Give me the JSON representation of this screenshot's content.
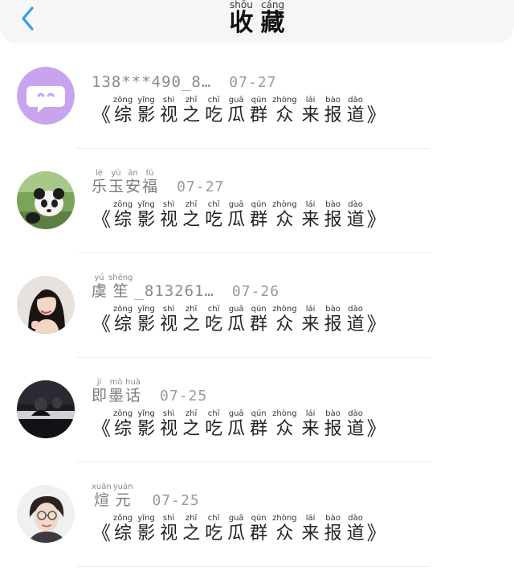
{
  "header": {
    "title": [
      {
        "py": "shōu",
        "hz": "收"
      },
      {
        "py": "cáng",
        "hz": "藏"
      }
    ]
  },
  "colors": {
    "accent": "#2f9ff0",
    "header_bg": "#f6f6f6"
  },
  "items": [
    {
      "avatar": "chat-bubble-avatar",
      "plain_name": "138***490_8…",
      "name_ruby": [],
      "date": "07-27"
    },
    {
      "avatar": "panda-photo-avatar",
      "plain_name": "",
      "name_ruby": [
        {
          "py": "lè",
          "hz": "乐"
        },
        {
          "py": "yù",
          "hz": "玉"
        },
        {
          "py": "ān",
          "hz": "安"
        },
        {
          "py": "fú",
          "hz": "福"
        }
      ],
      "date": "07-27"
    },
    {
      "avatar": "woman-portrait-avatar",
      "plain_name": "_813261…",
      "name_ruby": [
        {
          "py": "yú",
          "hz": "虞"
        },
        {
          "py": "shēng",
          "hz": "笙"
        }
      ],
      "date": "07-26"
    },
    {
      "avatar": "dark-photo-avatar",
      "plain_name": "",
      "name_ruby": [
        {
          "py": "jí",
          "hz": "即"
        },
        {
          "py": "mò",
          "hz": "墨"
        },
        {
          "py": "huà",
          "hz": "话"
        }
      ],
      "date": "07-25"
    },
    {
      "avatar": "man-glasses-avatar",
      "plain_name": "",
      "name_ruby": [
        {
          "py": "xuān",
          "hz": "煊"
        },
        {
          "py": "yuán",
          "hz": "元"
        }
      ],
      "date": "07-25"
    }
  ],
  "message": {
    "open_bracket": "《",
    "close_bracket": "》",
    "chars": [
      {
        "py": "zōng",
        "hz": "综"
      },
      {
        "py": "yǐng",
        "hz": "影"
      },
      {
        "py": "shì",
        "hz": "视"
      },
      {
        "py": "zhī",
        "hz": "之"
      },
      {
        "py": "chī",
        "hz": "吃"
      },
      {
        "py": "guā",
        "hz": "瓜"
      },
      {
        "py": "qún",
        "hz": "群"
      },
      {
        "py": "zhòng",
        "hz": "众"
      },
      {
        "py": "lái",
        "hz": "来"
      },
      {
        "py": "bào",
        "hz": "报"
      },
      {
        "py": "dào",
        "hz": "道"
      }
    ]
  }
}
